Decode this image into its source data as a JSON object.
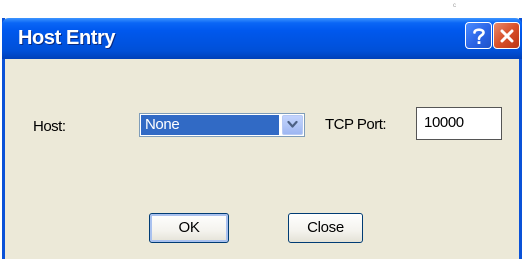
{
  "window": {
    "title": "Host Entry",
    "help_icon": "question-mark-icon",
    "close_icon": "close-x-icon"
  },
  "stray_mark": "c",
  "form": {
    "host_label": "Host:",
    "host_selected": "None",
    "dropdown_icon": "chevron-down-icon",
    "port_label": "TCP Port:",
    "port_value": "10000"
  },
  "buttons": {
    "ok_label": "OK",
    "close_label": "Close"
  },
  "colors": {
    "titlebar": "#0054e3",
    "dialog_background": "#ece9d8",
    "selection": "#316ac5",
    "close_button": "#d8502a"
  }
}
